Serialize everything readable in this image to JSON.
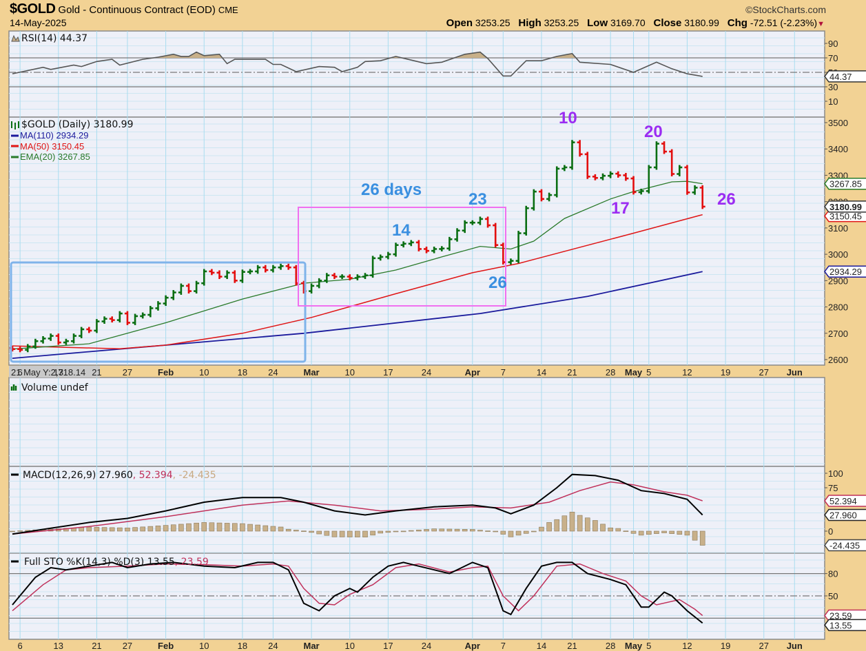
{
  "header": {
    "symbol": "$GOLD",
    "name": "Gold - Continuous Contract (EOD)",
    "exchange": "CME",
    "date": "14-May-2025",
    "copyright": "©StockCharts.com",
    "open_label": "Open",
    "open": "3253.25",
    "high_label": "High",
    "high": "3253.25",
    "low_label": "Low",
    "low": "3169.70",
    "close_label": "Close",
    "close": "3180.99",
    "chg_label": "Chg",
    "chg": "-72.51 (-2.23%)",
    "chg_arrow": "▼"
  },
  "colors": {
    "up": "#0a6e12",
    "down": "#e30e0e",
    "ma110": "#1a1a9c",
    "ma50": "#e01515",
    "ema20": "#2a7a2a",
    "blue_annotation": "#3a8fe0",
    "purple_annotation": "#9b2cf2",
    "box_blue": "#7fb3ea",
    "box_pink": "#f070f0",
    "signal": "#c0305a",
    "histogram": "#c8b08a"
  },
  "rsi": {
    "legend": "RSI(14) 44.37",
    "ticks": [
      "90",
      "70",
      "50",
      "30",
      "10"
    ],
    "tag": "44.37"
  },
  "price": {
    "legend": "$GOLD (Daily) 3180.99",
    "ma110": "MA(110) 2934.29",
    "ma50": "MA(50) 3150.45",
    "ema20": "EMA(20) 3267.85",
    "ticks": [
      "3500",
      "3400",
      "3300",
      "3200",
      "3100",
      "3000",
      "2900",
      "2800",
      "2700",
      "2600"
    ],
    "tags": {
      "ema20": "3267.85",
      "close": "3180.99",
      "ma50": "3150.45",
      "ma110": "2934.29"
    }
  },
  "crosshair": "21 May Y:2,718.14",
  "volume": {
    "legend": "Volume undef"
  },
  "macd": {
    "legend": "MACD(12,26,9) 27.960",
    "signal_legend": ", 52.394",
    "hist_legend": ", -24.435",
    "ticks": [
      "100",
      "75",
      "0"
    ],
    "tags": {
      "signal": "52.394",
      "macd": "27.960",
      "hist": "-24.435"
    }
  },
  "sto": {
    "legend": "Full STO %K(14,3) %D(3) 13.55",
    "d_legend": ", 23.59",
    "ticks": [
      "80",
      "50"
    ],
    "tags": {
      "d": "23.59",
      "k": "13.55"
    }
  },
  "annotations": {
    "days": "26 days",
    "a14": "14",
    "a23": "23",
    "a26": "26",
    "p10": "10",
    "p20": "20",
    "p17": "17",
    "p26": "26"
  },
  "chart_data": {
    "type": "ohlc",
    "title": "$GOLD Gold - Continuous Contract (EOD)",
    "x_unit": "trading days since 3-Jan-2025",
    "x_ticks": [
      {
        "label": "6",
        "t": 1
      },
      {
        "label": "13",
        "t": 6
      },
      {
        "label": "21",
        "t": 11
      },
      {
        "label": "27",
        "t": 15
      },
      {
        "label": "Feb",
        "t": 20,
        "bold": true
      },
      {
        "label": "10",
        "t": 25
      },
      {
        "label": "18",
        "t": 30
      },
      {
        "label": "24",
        "t": 34
      },
      {
        "label": "Mar",
        "t": 39,
        "bold": true
      },
      {
        "label": "10",
        "t": 44
      },
      {
        "label": "17",
        "t": 49
      },
      {
        "label": "24",
        "t": 54
      },
      {
        "label": "Apr",
        "t": 60,
        "bold": true
      },
      {
        "label": "7",
        "t": 64
      },
      {
        "label": "14",
        "t": 69
      },
      {
        "label": "21",
        "t": 73
      },
      {
        "label": "28",
        "t": 78
      },
      {
        "label": "May",
        "t": 81,
        "bold": true
      },
      {
        "label": "5",
        "t": 83
      },
      {
        "label": "12",
        "t": 88
      },
      {
        "label": "19",
        "t": 93
      },
      {
        "label": "27",
        "t": 98
      },
      {
        "label": "Jun",
        "t": 102,
        "bold": true
      }
    ],
    "closes": [
      2640,
      2637,
      2650,
      2670,
      2680,
      2690,
      2665,
      2670,
      2690,
      2715,
      2710,
      2745,
      2755,
      2750,
      2775,
      2740,
      2765,
      2770,
      2795,
      2813,
      2835,
      2855,
      2880,
      2860,
      2890,
      2935,
      2930,
      2915,
      2930,
      2900,
      2933,
      2935,
      2950,
      2940,
      2950,
      2955,
      2950,
      2890,
      2860,
      2880,
      2900,
      2920,
      2915,
      2915,
      2910,
      2915,
      2920,
      2985,
      2990,
      3000,
      3035,
      3040,
      3045,
      3020,
      3013,
      3020,
      3022,
      3057,
      3090,
      3120,
      3120,
      3134,
      3110,
      3035,
      2970,
      2975,
      3080,
      3175,
      3238,
      3210,
      3225,
      3325,
      3330,
      3425,
      3380,
      3295,
      3290,
      3298,
      3306,
      3300,
      3288,
      3236,
      3240,
      3330,
      3420,
      3390,
      3305,
      3330,
      3235,
      3253,
      3180.99
    ],
    "price_range": [
      2580,
      3520
    ],
    "ma110": [
      [
        0,
        2605
      ],
      [
        38,
        2700
      ],
      [
        61,
        2775
      ],
      [
        75,
        2840
      ],
      [
        90,
        2934.29
      ]
    ],
    "ma50": [
      [
        0,
        2652
      ],
      [
        14,
        2641
      ],
      [
        20,
        2655
      ],
      [
        30,
        2700
      ],
      [
        39,
        2760
      ],
      [
        50,
        2850
      ],
      [
        60,
        2930
      ],
      [
        66,
        2965
      ],
      [
        81,
        3080
      ],
      [
        90,
        3150.45
      ]
    ],
    "ema20": [
      [
        0,
        2640
      ],
      [
        10,
        2660
      ],
      [
        20,
        2740
      ],
      [
        30,
        2830
      ],
      [
        38,
        2890
      ],
      [
        44,
        2905
      ],
      [
        50,
        2940
      ],
      [
        56,
        2990
      ],
      [
        61,
        3030
      ],
      [
        65,
        3020
      ],
      [
        68,
        3050
      ],
      [
        72,
        3136
      ],
      [
        78,
        3210
      ],
      [
        81,
        3238
      ],
      [
        86,
        3275
      ],
      [
        88,
        3277
      ],
      [
        90,
        3267.85
      ]
    ],
    "rsi": [
      [
        0,
        48
      ],
      [
        4,
        57
      ],
      [
        5,
        54
      ],
      [
        8,
        60
      ],
      [
        9,
        58
      ],
      [
        11,
        65
      ],
      [
        13,
        68
      ],
      [
        14,
        60
      ],
      [
        17,
        68
      ],
      [
        19,
        71
      ],
      [
        21,
        75
      ],
      [
        22,
        72
      ],
      [
        23,
        72
      ],
      [
        24,
        78
      ],
      [
        25,
        73
      ],
      [
        27,
        75
      ],
      [
        28,
        62
      ],
      [
        29,
        68
      ],
      [
        33,
        68
      ],
      [
        34,
        61
      ],
      [
        35,
        61
      ],
      [
        37,
        51
      ],
      [
        40,
        58
      ],
      [
        42,
        57
      ],
      [
        43,
        51
      ],
      [
        45,
        57
      ],
      [
        46,
        65
      ],
      [
        48,
        66
      ],
      [
        50,
        72
      ],
      [
        52,
        67
      ],
      [
        54,
        62
      ],
      [
        56,
        64
      ],
      [
        59,
        75
      ],
      [
        61,
        78
      ],
      [
        62,
        69
      ],
      [
        64,
        45
      ],
      [
        65,
        45
      ],
      [
        67,
        66
      ],
      [
        69,
        66
      ],
      [
        71,
        72
      ],
      [
        73,
        76
      ],
      [
        74,
        64
      ],
      [
        78,
        61
      ],
      [
        81,
        50
      ],
      [
        84,
        64
      ],
      [
        86,
        55
      ],
      [
        88,
        48
      ],
      [
        90,
        44.37
      ]
    ],
    "macd": [
      [
        0,
        -5
      ],
      [
        5,
        5
      ],
      [
        10,
        15
      ],
      [
        15,
        22
      ],
      [
        20,
        35
      ],
      [
        25,
        50
      ],
      [
        30,
        58
      ],
      [
        35,
        58
      ],
      [
        38,
        50
      ],
      [
        42,
        35
      ],
      [
        46,
        28
      ],
      [
        50,
        35
      ],
      [
        55,
        42
      ],
      [
        60,
        45
      ],
      [
        63,
        40
      ],
      [
        65,
        30
      ],
      [
        68,
        45
      ],
      [
        71,
        75
      ],
      [
        73,
        98
      ],
      [
        76,
        96
      ],
      [
        79,
        88
      ],
      [
        82,
        70
      ],
      [
        85,
        65
      ],
      [
        88,
        55
      ],
      [
        90,
        27.96
      ]
    ],
    "signal": [
      [
        0,
        -5
      ],
      [
        10,
        8
      ],
      [
        20,
        25
      ],
      [
        30,
        45
      ],
      [
        36,
        52
      ],
      [
        42,
        45
      ],
      [
        48,
        35
      ],
      [
        55,
        38
      ],
      [
        60,
        42
      ],
      [
        65,
        40
      ],
      [
        70,
        50
      ],
      [
        74,
        70
      ],
      [
        78,
        85
      ],
      [
        81,
        80
      ],
      [
        85,
        68
      ],
      [
        88,
        62
      ],
      [
        90,
        52.394
      ]
    ],
    "sto_k": [
      [
        0,
        38
      ],
      [
        3,
        75
      ],
      [
        5,
        88
      ],
      [
        7,
        85
      ],
      [
        10,
        90
      ],
      [
        13,
        95
      ],
      [
        15,
        88
      ],
      [
        18,
        93
      ],
      [
        21,
        95
      ],
      [
        25,
        90
      ],
      [
        29,
        88
      ],
      [
        32,
        95
      ],
      [
        34,
        95
      ],
      [
        36,
        85
      ],
      [
        38,
        40
      ],
      [
        40,
        30
      ],
      [
        42,
        50
      ],
      [
        44,
        60
      ],
      [
        45,
        55
      ],
      [
        47,
        75
      ],
      [
        49,
        90
      ],
      [
        51,
        95
      ],
      [
        53,
        90
      ],
      [
        55,
        85
      ],
      [
        57,
        80
      ],
      [
        60,
        95
      ],
      [
        62,
        88
      ],
      [
        64,
        30
      ],
      [
        65,
        25
      ],
      [
        67,
        60
      ],
      [
        69,
        90
      ],
      [
        71,
        95
      ],
      [
        73,
        95
      ],
      [
        75,
        80
      ],
      [
        78,
        72
      ],
      [
        80,
        65
      ],
      [
        82,
        35
      ],
      [
        83,
        35
      ],
      [
        85,
        55
      ],
      [
        86,
        50
      ],
      [
        88,
        30
      ],
      [
        90,
        13.55
      ]
    ],
    "sto_d": [
      [
        0,
        30
      ],
      [
        4,
        65
      ],
      [
        7,
        85
      ],
      [
        10,
        88
      ],
      [
        15,
        90
      ],
      [
        20,
        93
      ],
      [
        25,
        92
      ],
      [
        30,
        90
      ],
      [
        34,
        93
      ],
      [
        36,
        90
      ],
      [
        38,
        60
      ],
      [
        40,
        40
      ],
      [
        42,
        38
      ],
      [
        44,
        52
      ],
      [
        47,
        65
      ],
      [
        50,
        88
      ],
      [
        53,
        93
      ],
      [
        57,
        82
      ],
      [
        60,
        88
      ],
      [
        62,
        90
      ],
      [
        64,
        50
      ],
      [
        66,
        30
      ],
      [
        68,
        50
      ],
      [
        71,
        90
      ],
      [
        74,
        93
      ],
      [
        77,
        80
      ],
      [
        80,
        70
      ],
      [
        82,
        50
      ],
      [
        84,
        38
      ],
      [
        87,
        45
      ],
      [
        89,
        32
      ],
      [
        90,
        23.59
      ]
    ]
  }
}
